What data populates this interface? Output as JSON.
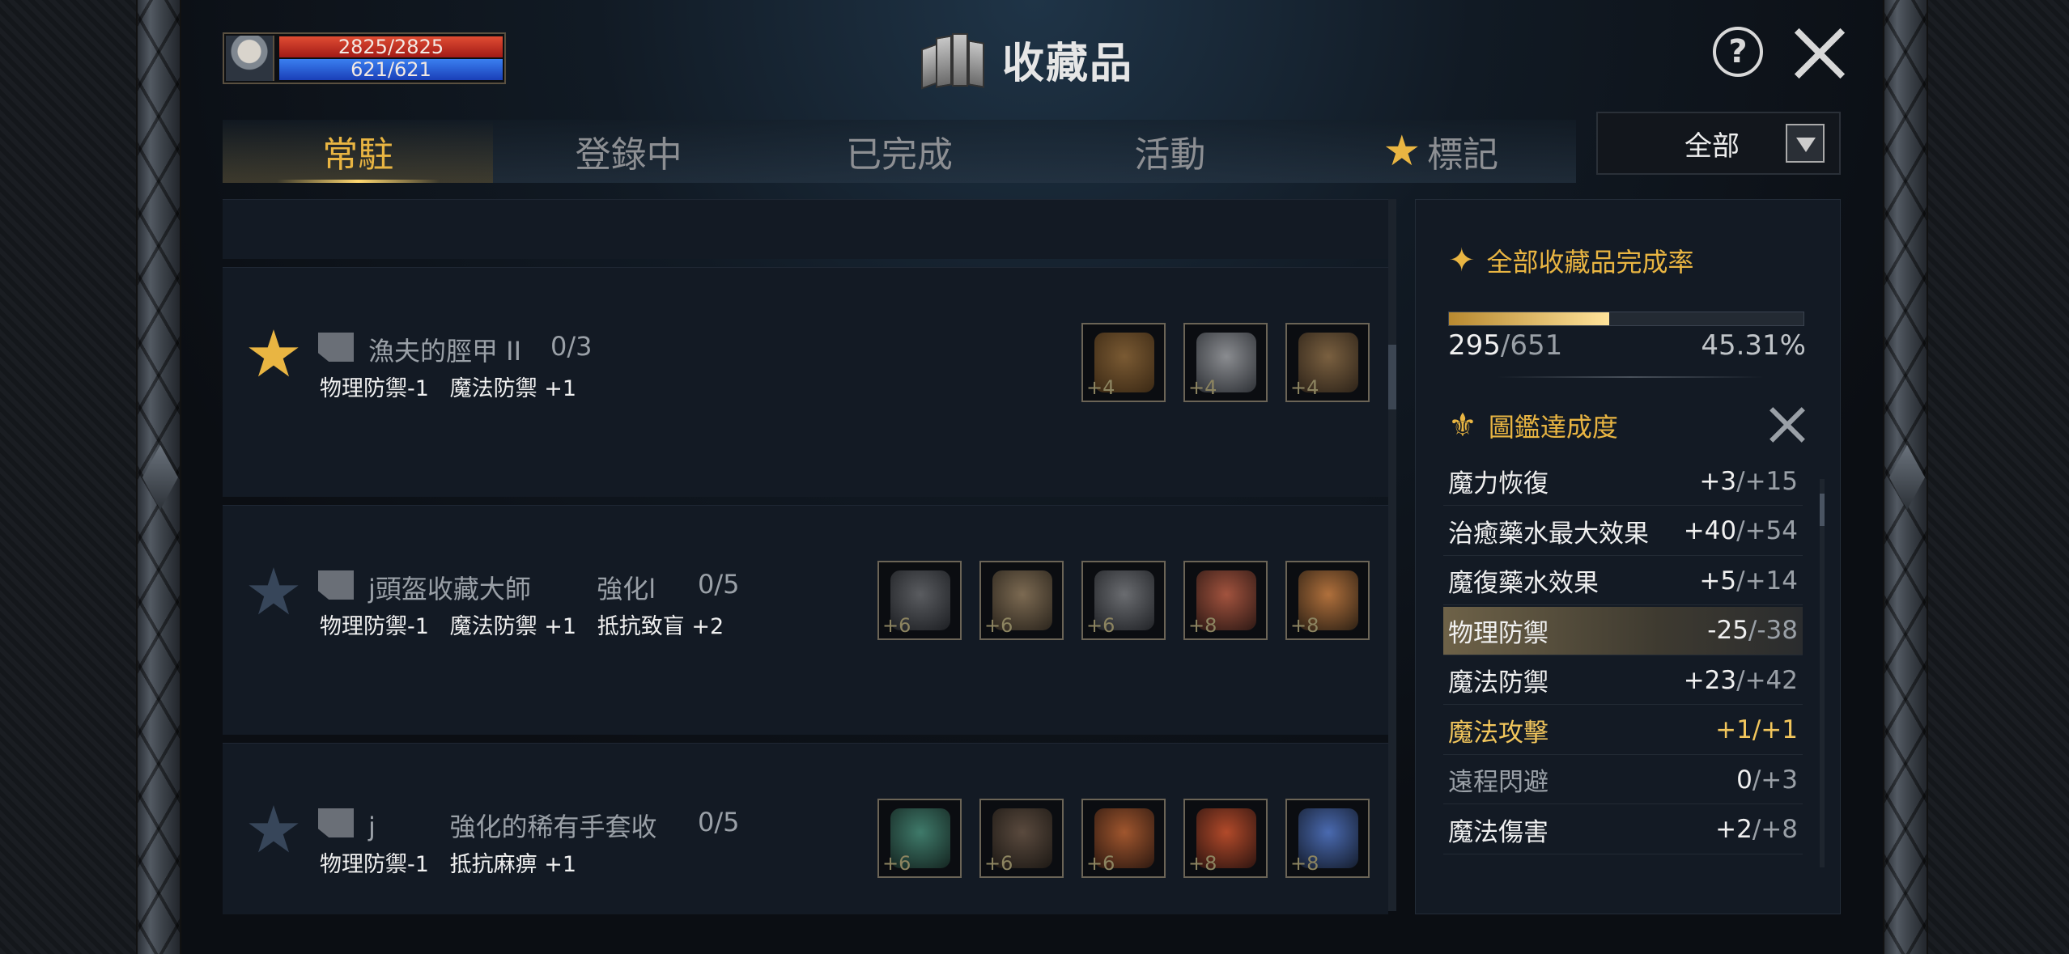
{
  "player": {
    "hp": "2825/2825",
    "mp": "621/621",
    "hp_pct": 100,
    "mp_pct": 100
  },
  "header": {
    "title": "收藏品",
    "help_icon": "question-circle-icon",
    "close_icon": "close-icon"
  },
  "tabs": [
    {
      "label": "常駐",
      "active": true
    },
    {
      "label": "登錄中",
      "active": false
    },
    {
      "label": "已完成",
      "active": false
    },
    {
      "label": "活動",
      "active": false
    },
    {
      "label": "標記",
      "active": false,
      "icon": "star-icon"
    }
  ],
  "filter": {
    "label": "全部"
  },
  "collections": [
    {
      "starred": true,
      "name": "漁夫的脛甲 II",
      "count": "0/3",
      "stats": "物理防禦-1   魔法防禦 +1",
      "items": [
        {
          "level": "+4"
        },
        {
          "level": "+4"
        },
        {
          "level": "+4"
        }
      ]
    },
    {
      "starred": false,
      "name": "j頭盔收藏大師        強化l",
      "count": "0/5",
      "stats": "物理防禦-1   魔法防禦 +1   抵抗致盲 +2",
      "items": [
        {
          "level": "+6"
        },
        {
          "level": "+6"
        },
        {
          "level": "+6"
        },
        {
          "level": "+8"
        },
        {
          "level": "+8"
        }
      ]
    },
    {
      "starred": false,
      "name": "j         強化的稀有手套收",
      "count": "0/5",
      "stats": "物理防禦-1   抵抗麻痹 +1",
      "items": [
        {
          "level": "+6"
        },
        {
          "level": "+6"
        },
        {
          "level": "+6"
        },
        {
          "level": "+8"
        },
        {
          "level": "+8"
        }
      ]
    }
  ],
  "panel": {
    "completion_title": "全部收藏品完成率",
    "completed": "295",
    "total": "/651",
    "percent": "45.31%",
    "progress": 0.4531,
    "codex_title": "圖鑑達成度",
    "stats": [
      {
        "name": "魔力恢復",
        "value": "+3",
        "max": "/+15",
        "style": ""
      },
      {
        "name": "治癒藥水最大效果",
        "value": "+40",
        "max": "/+54",
        "style": ""
      },
      {
        "name": "魔復藥水效果",
        "value": "+5",
        "max": "/+14",
        "style": ""
      },
      {
        "name": "物理防禦",
        "value": "-25",
        "max": "/-38",
        "style": "hl"
      },
      {
        "name": "魔法防禦",
        "value": "+23",
        "max": "/+42",
        "style": ""
      },
      {
        "name": "魔法攻擊",
        "value": "+1",
        "max": "/+1",
        "style": "gold"
      },
      {
        "name": "遠程閃避",
        "value": "0",
        "max": "/+3",
        "style": "dim"
      },
      {
        "name": "魔法傷害",
        "value": "+2",
        "max": "/+8",
        "style": ""
      }
    ]
  }
}
